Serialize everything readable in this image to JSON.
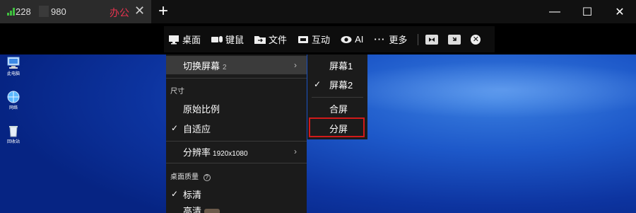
{
  "tab": {
    "host_prefix": "228",
    "host_suffix": "980",
    "label": "办公",
    "close": "✕",
    "new_tab": "+"
  },
  "window": {
    "minimize": "—",
    "maximize": "☐",
    "close": "✕"
  },
  "toolbar": {
    "items": [
      {
        "label": "桌面",
        "icon": "monitor-icon"
      },
      {
        "label": "键鼠",
        "icon": "keyboard-mouse-icon"
      },
      {
        "label": "文件",
        "icon": "folder-transfer-icon"
      },
      {
        "label": "互动",
        "icon": "chat-box-icon"
      },
      {
        "label": "AI",
        "icon": "eye-icon"
      },
      {
        "label": "更多",
        "icon": "more-dots-icon"
      }
    ],
    "more_dots": "···"
  },
  "desktop_icons": [
    {
      "label": "此电脑",
      "icon": "computer-icon"
    },
    {
      "label": "网络",
      "icon": "network-icon"
    },
    {
      "label": "回收站",
      "icon": "recycle-bin-icon"
    }
  ],
  "menu": {
    "switch_screen": "切换屏幕",
    "switch_screen_count": "2",
    "size_header": "尺寸",
    "original_ratio": "原始比例",
    "adaptive": "自适应",
    "resolution": "分辨率",
    "resolution_value": "1920x1080",
    "quality_header": "桌面质量",
    "quality_standard": "标清",
    "quality_hd": "高清",
    "check": "✓",
    "arrow": "›",
    "help": "?"
  },
  "submenu": {
    "screen1": "屏幕1",
    "screen2": "屏幕2",
    "merge": "合屏",
    "split": "分屏",
    "check": "✓"
  },
  "colors": {
    "accent_red": "#e8334f",
    "highlight_border": "#d11a1a",
    "signal_green": "#3fbf3f",
    "desktop_blue": "#1d58c9"
  }
}
